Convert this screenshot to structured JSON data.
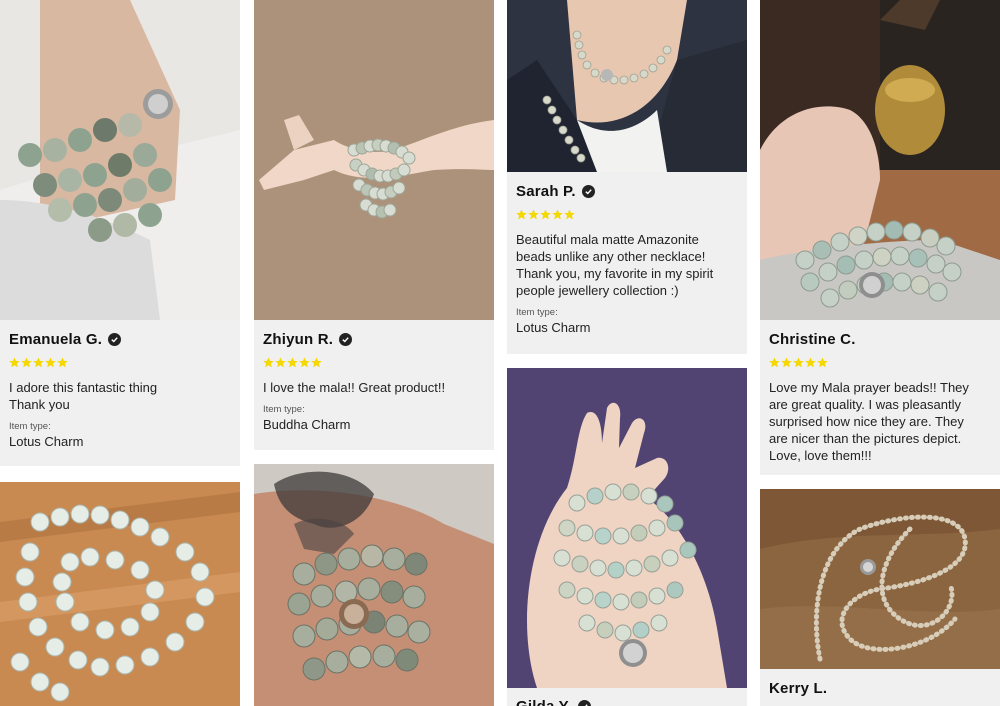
{
  "colors": {
    "star": "#f5d800",
    "card_bg": "#f0f0f0",
    "text": "#222222"
  },
  "icons": {
    "verified": "check-circle-icon",
    "rating": "star-icon"
  },
  "reviews": [
    {
      "name": "Emanuela G.",
      "rating": 5,
      "text_lines": [
        "I adore this fantastic thing",
        "Thank you"
      ],
      "item_type_label": "Item type:",
      "item_type": "Lotus Charm"
    },
    {
      "name": "Zhiyun R.",
      "rating": 5,
      "text_lines": [
        "I love the mala!! Great product!!"
      ],
      "item_type_label": "Item type:",
      "item_type": "Buddha Charm"
    },
    {
      "name": "Sarah P.",
      "rating": 5,
      "text_lines": [
        "Beautiful mala matte Amazonite",
        "beads unlike any other necklace!",
        "Thank you, my favorite in my spirit",
        "people jewellery collection :)"
      ],
      "item_type_label": "Item type:",
      "item_type": "Lotus Charm"
    },
    {
      "name": "Christine C.",
      "rating": 5,
      "text_lines": [
        "Love my Mala prayer beads!! They",
        "are great quality. I was pleasantly",
        "surprised how nice they are. They",
        "are nicer than the pictures depict.",
        "Love, love them!!!"
      ]
    },
    {
      "name": "Gilda Y."
    },
    {
      "name": "Kerry L."
    }
  ]
}
